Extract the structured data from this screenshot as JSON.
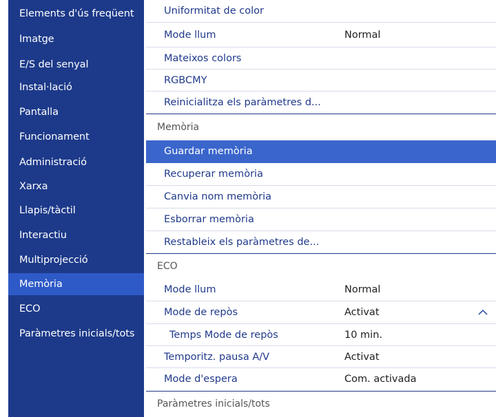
{
  "sidebar": {
    "items": [
      {
        "label": "Elements d'ús freqüent"
      },
      {
        "label": "Imatge"
      },
      {
        "label": "E/S del senyal"
      },
      {
        "label": "Instal·lació"
      },
      {
        "label": "Pantalla"
      },
      {
        "label": "Funcionament"
      },
      {
        "label": "Administració"
      },
      {
        "label": "Xarxa"
      },
      {
        "label": "Llapis/tàctil"
      },
      {
        "label": "Interactiu"
      },
      {
        "label": "Multiprojecció"
      },
      {
        "label": "Memòria"
      },
      {
        "label": "ECO"
      },
      {
        "label": "Paràmetres inicials/tots"
      }
    ],
    "active": "Memòria"
  },
  "main": {
    "image_rows": [
      {
        "label": "Uniformitat de color",
        "value": ""
      },
      {
        "label": "Mode llum",
        "value": "Normal"
      },
      {
        "label": "Mateixos colors",
        "value": ""
      },
      {
        "label": "RGBCMY",
        "value": ""
      },
      {
        "label": "Reinicialitza els paràmetres d...",
        "value": ""
      }
    ],
    "memory_section": {
      "title": "Memòria",
      "rows": [
        {
          "label": "Guardar memòria"
        },
        {
          "label": "Recuperar memòria"
        },
        {
          "label": "Canvia nom memòria"
        },
        {
          "label": "Esborrar memòria"
        },
        {
          "label": "Restableix els paràmetres de..."
        }
      ],
      "selected": "Guardar memòria"
    },
    "eco_section": {
      "title": "ECO",
      "rows": [
        {
          "label": "Mode llum",
          "value": "Normal"
        },
        {
          "label": "Mode de repòs",
          "value": "Activat"
        },
        {
          "label": "Temps Mode de repòs",
          "value": "10 min."
        },
        {
          "label": "Temporitz. pausa A/V",
          "value": "Activat"
        },
        {
          "label": "Mode d'espera",
          "value": "Com. activada"
        }
      ]
    },
    "reset_section": {
      "title": "Paràmetres inicials/tots"
    }
  },
  "colors": {
    "sidebar_bg": "#1d3a8a",
    "sidebar_active": "#2e5ac8",
    "selected_row": "#3a66cc",
    "row_text": "#203a8a"
  }
}
